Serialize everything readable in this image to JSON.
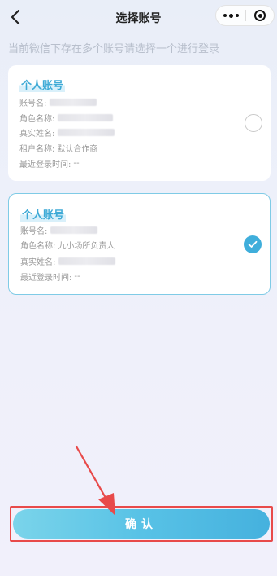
{
  "nav": {
    "title": "选择账号"
  },
  "hint": "当前微信下存在多个账号请选择一个进行登录",
  "accounts": [
    {
      "tag": "个人账号",
      "fields": {
        "account_label": "账号名:",
        "role_label": "角色名称:",
        "realname_label": "真实姓名:",
        "tenant_label": "租户名称:",
        "tenant_value": "默认合作商",
        "lastlogin_label": "最近登录时间:",
        "lastlogin_value": "--"
      },
      "selected": false
    },
    {
      "tag": "个人账号",
      "fields": {
        "account_label": "账号名:",
        "role_label": "角色名称:",
        "role_value": "九小场所负责人",
        "realname_label": "真实姓名:",
        "lastlogin_label": "最近登录时间:",
        "lastlogin_value": "--"
      },
      "selected": true
    }
  ],
  "confirm_label": "确认",
  "colors": {
    "accent": "#3faedb",
    "highlight_border": "#e84a4a"
  },
  "icons": {
    "back": "chevron-left-icon",
    "menu": "more-dots-icon",
    "close": "target-icon",
    "check": "check-icon"
  }
}
